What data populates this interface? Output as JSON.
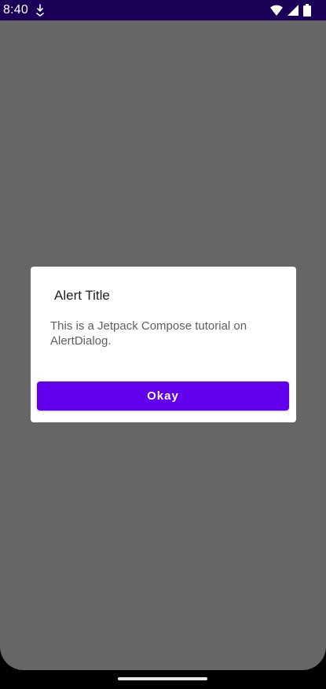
{
  "status_bar": {
    "time": "8:40",
    "background": "#1c0057",
    "icons": [
      "download-icon",
      "wifi-icon",
      "signal-icon",
      "battery-icon"
    ]
  },
  "app": {
    "scrim_color": "#666666"
  },
  "dialog": {
    "title": "Alert Title",
    "message": "This is a Jetpack Compose tutorial on AlertDialog.",
    "confirm_label": "Okay",
    "accent_color": "#6200ee"
  },
  "nav_bar": {
    "icon": "gesture-handle"
  }
}
